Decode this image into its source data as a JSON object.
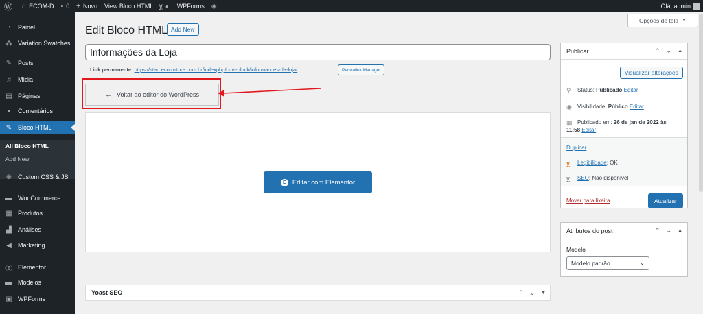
{
  "adminbar": {
    "site_name": "ECOM-D",
    "comments_count": "0",
    "new_label": "Novo",
    "view_label": "View Bloco HTML",
    "wpforms_label": "WPForms",
    "greeting": "Olá, admin"
  },
  "sidebar": {
    "items": [
      {
        "label": "Painel",
        "icon": "dashboard-icon"
      },
      {
        "label": "Variation Swatches",
        "icon": "swatches-icon"
      },
      {
        "label": "Posts",
        "icon": "pin-icon"
      },
      {
        "label": "Mídia",
        "icon": "media-icon"
      },
      {
        "label": "Páginas",
        "icon": "page-icon"
      },
      {
        "label": "Comentários",
        "icon": "comment-icon"
      },
      {
        "label": "Bloco HTML",
        "icon": "pin-icon"
      },
      {
        "label": "Custom CSS & JS",
        "icon": "plus-circle-icon"
      },
      {
        "label": "WooCommerce",
        "icon": "woo-icon"
      },
      {
        "label": "Produtos",
        "icon": "box-icon"
      },
      {
        "label": "Análises",
        "icon": "chart-bar-icon"
      },
      {
        "label": "Marketing",
        "icon": "megaphone-icon"
      },
      {
        "label": "Elementor",
        "icon": "elementor-icon"
      },
      {
        "label": "Modelos",
        "icon": "folder-icon"
      },
      {
        "label": "WPForms",
        "icon": "form-icon"
      }
    ],
    "sub": {
      "all": "All Bloco HTML",
      "add": "Add New"
    }
  },
  "header": {
    "screen_options": "Opções de tela",
    "title": "Edit Bloco HTML",
    "add_new": "Add New"
  },
  "post": {
    "title_value": "Informações da Loja",
    "permalink_label": "Link permanente:",
    "permalink_url": "https://start.ecomstore.com.br/indexphp/cms-block/informacoes-da-loja/",
    "permalink_manager": "Permalink Manager",
    "back_label": "Voltar ao editor do WordPress",
    "elementor_label": "Editar com Elementor"
  },
  "publish": {
    "title": "Publicar",
    "preview": "Visualizar alterações",
    "status_label": "Status:",
    "status_value": "Publicado",
    "visibility_label": "Visibilidade:",
    "visibility_value": "Público",
    "published_label": "Publicado em:",
    "published_value": "26 de jan de 2022 às",
    "published_time": "11:58",
    "edit": "Editar",
    "duplicate": "Duplicar",
    "readability_label": "Legibilidade",
    "readability_value": ": OK",
    "seo_label": "SEO",
    "seo_value": ": Não disponível",
    "trash": "Mover para lixeira",
    "update": "Atualizar"
  },
  "attributes": {
    "title": "Atributos do post",
    "model_label": "Modelo",
    "model_value": "Modelo padrão"
  },
  "yoast": {
    "title": "Yoast SEO"
  },
  "colors": {
    "accent": "#2271b1",
    "adminbar": "#1d2327",
    "highlight": "#e2181f"
  }
}
